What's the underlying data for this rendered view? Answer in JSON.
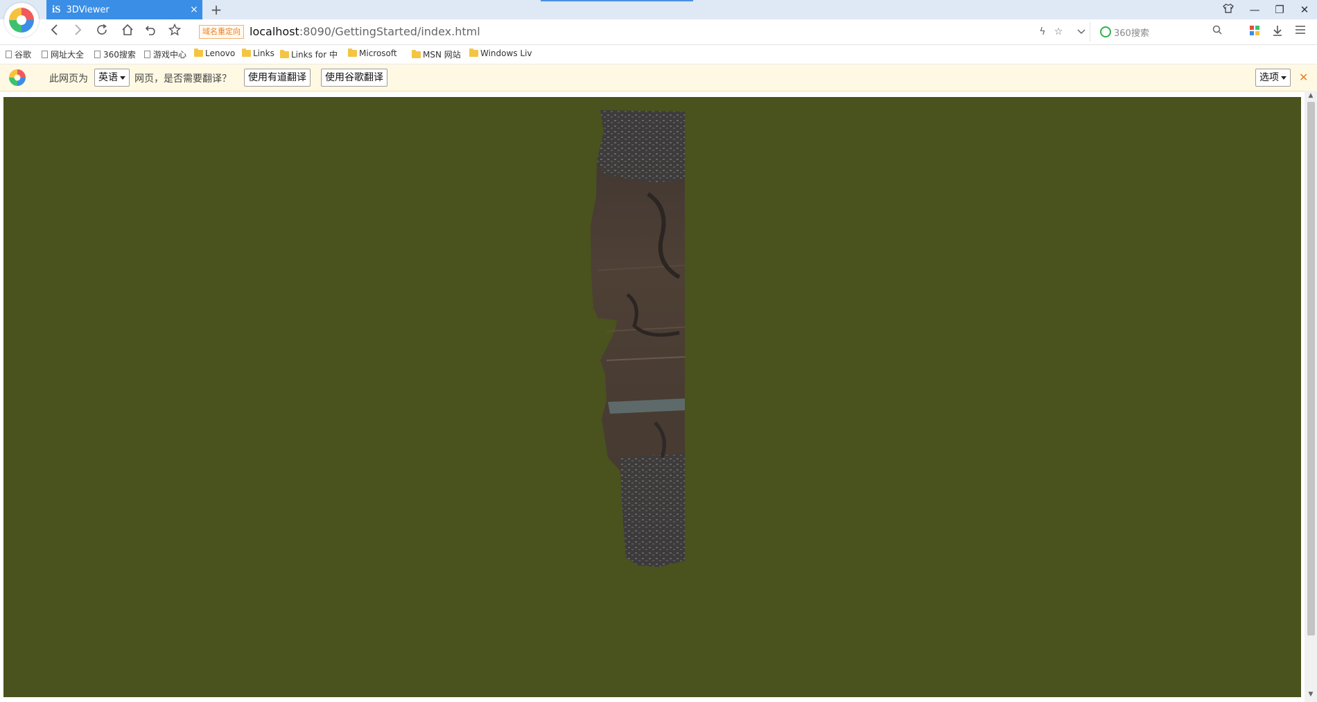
{
  "browser": {
    "tab_title": "3DViewer",
    "tab_favicon": "iS",
    "tab_close": "×",
    "new_tab": "+",
    "window_controls": {
      "skin": "shirt-icon",
      "minimize": "—",
      "restore": "❐",
      "close": "✕"
    }
  },
  "address_bar": {
    "redirect_badge": "域名重定向",
    "url_host": "localhost",
    "url_rest": ":8090/GettingStarted/index.html",
    "search_placeholder": "360搜索"
  },
  "bookmarks": [
    {
      "label": "谷歌",
      "type": "page"
    },
    {
      "label": "网址大全",
      "type": "page"
    },
    {
      "label": "360搜索",
      "type": "page"
    },
    {
      "label": "游戏中心",
      "type": "page"
    },
    {
      "label": "Lenovo",
      "type": "folder"
    },
    {
      "label": "Links",
      "type": "folder"
    },
    {
      "label": "Links for 中",
      "type": "folder"
    },
    {
      "label": "Microsoft",
      "type": "folder"
    },
    {
      "label": "MSN 网站",
      "type": "folder"
    },
    {
      "label": "Windows Liv",
      "type": "folder"
    }
  ],
  "translate_bar": {
    "prefix": "此网页为",
    "language": "英语",
    "question": "网页，是否需要翻译？",
    "youdao_button": "使用有道翻译",
    "google_button": "使用谷歌翻译",
    "options_button": "选项",
    "close": "✕"
  },
  "viewer": {
    "background_color": "#4a521e",
    "content": "aerial-imagery-strip"
  },
  "colors": {
    "tab_active": "#3a8ee6",
    "titlebar": "#dfe8f5",
    "translate_bar_bg": "#fff9e3",
    "accent_orange": "#e8802b"
  }
}
